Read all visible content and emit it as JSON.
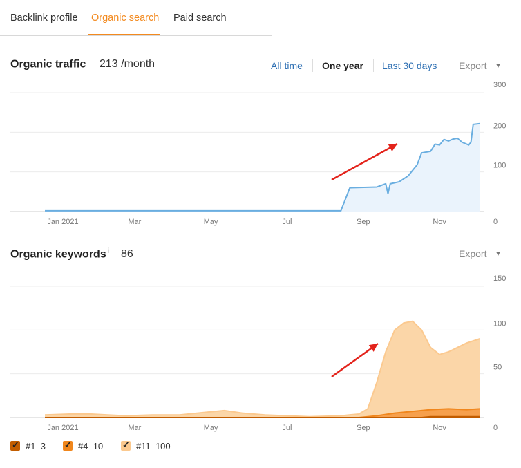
{
  "tabs": [
    {
      "label": "Backlink profile"
    },
    {
      "label": "Organic search"
    },
    {
      "label": "Paid search"
    }
  ],
  "traffic": {
    "title": "Organic traffic",
    "info": "i",
    "value": "213 /month",
    "ranges": [
      "All time",
      "One year",
      "Last 30 days"
    ],
    "active_range": "One year",
    "export_label": "Export",
    "export_caret": "▼"
  },
  "keywords": {
    "title": "Organic keywords",
    "info": "i",
    "value": "86",
    "export_label": "Export",
    "export_caret": "▼"
  },
  "legend": [
    {
      "label": "#1–3",
      "color": "#c25d00"
    },
    {
      "label": "#4–10",
      "color": "#f0861c"
    },
    {
      "label": "#11–100",
      "color": "#fbc98f"
    }
  ],
  "colors": {
    "accent": "#f38a1f",
    "link": "#2d6fb3",
    "traffic_line": "#6aaee0",
    "traffic_fill": "#eaf3fc",
    "annotation_arrow": "#e3231b"
  },
  "chart_data": [
    {
      "type": "area",
      "title": "Organic traffic",
      "x_ticks": [
        "Jan 2021",
        "Mar",
        "May",
        "Jul",
        "Sep",
        "Nov"
      ],
      "y_ticks": [
        "300",
        "200",
        "100",
        "0"
      ],
      "ylim": [
        0,
        300
      ],
      "grid": true,
      "series": [
        {
          "values": [
            [
              2020.96,
              2
            ],
            [
              2021.05,
              2
            ],
            [
              2021.3,
              2
            ],
            [
              2021.5,
              2
            ],
            [
              2021.62,
              2
            ],
            [
              2021.64,
              60
            ],
            [
              2021.7,
              62
            ],
            [
              2021.72,
              70
            ],
            [
              2021.725,
              45
            ],
            [
              2021.73,
              70
            ],
            [
              2021.75,
              75
            ],
            [
              2021.77,
              90
            ],
            [
              2021.79,
              118
            ],
            [
              2021.8,
              148
            ],
            [
              2021.82,
              152
            ],
            [
              2021.83,
              170
            ],
            [
              2021.84,
              168
            ],
            [
              2021.85,
              182
            ],
            [
              2021.86,
              178
            ],
            [
              2021.87,
              183
            ],
            [
              2021.88,
              185
            ],
            [
              2021.89,
              175
            ],
            [
              2021.905,
              168
            ],
            [
              2021.91,
              175
            ],
            [
              2021.915,
              220
            ],
            [
              2021.93,
              222
            ]
          ]
        }
      ]
    },
    {
      "type": "area",
      "title": "Organic keywords",
      "x_ticks": [
        "Jan 2021",
        "Mar",
        "May",
        "Jul",
        "Sep",
        "Nov"
      ],
      "y_ticks": [
        "150",
        "100",
        "50",
        "0"
      ],
      "ylim": [
        0,
        150
      ],
      "grid": true,
      "series": [
        {
          "name": "#11–100",
          "values": [
            [
              2020.96,
              3
            ],
            [
              2021.02,
              4
            ],
            [
              2021.06,
              4
            ],
            [
              2021.1,
              3
            ],
            [
              2021.14,
              2
            ],
            [
              2021.2,
              3
            ],
            [
              2021.26,
              3
            ],
            [
              2021.32,
              6
            ],
            [
              2021.36,
              8
            ],
            [
              2021.4,
              5
            ],
            [
              2021.45,
              3
            ],
            [
              2021.5,
              2
            ],
            [
              2021.55,
              1
            ],
            [
              2021.62,
              2
            ],
            [
              2021.66,
              4
            ],
            [
              2021.68,
              10
            ],
            [
              2021.7,
              40
            ],
            [
              2021.72,
              75
            ],
            [
              2021.74,
              100
            ],
            [
              2021.76,
              108
            ],
            [
              2021.78,
              110
            ],
            [
              2021.8,
              100
            ],
            [
              2021.82,
              80
            ],
            [
              2021.84,
              72
            ],
            [
              2021.86,
              75
            ],
            [
              2021.88,
              80
            ],
            [
              2021.9,
              85
            ],
            [
              2021.93,
              90
            ]
          ]
        },
        {
          "name": "#4–10",
          "values": [
            [
              2020.96,
              0
            ],
            [
              2021.66,
              0
            ],
            [
              2021.7,
              2
            ],
            [
              2021.74,
              5
            ],
            [
              2021.78,
              7
            ],
            [
              2021.82,
              9
            ],
            [
              2021.86,
              10
            ],
            [
              2021.9,
              9
            ],
            [
              2021.93,
              10
            ]
          ]
        },
        {
          "name": "#1–3",
          "values": [
            [
              2020.96,
              0
            ],
            [
              2021.8,
              0
            ],
            [
              2021.82,
              1
            ],
            [
              2021.88,
              1
            ],
            [
              2021.93,
              1
            ]
          ]
        }
      ]
    }
  ]
}
